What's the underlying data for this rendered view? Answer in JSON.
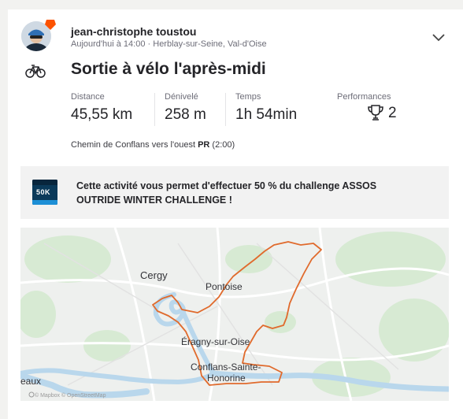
{
  "activity": {
    "athlete_name": "jean-christophe toustou",
    "date_time": "Aujourd'hui à 14:00",
    "location": "Herblay-sur-Seine, Val-d'Oise",
    "title": "Sortie à vélo l'après-midi",
    "sport_icon": "bike-icon",
    "expand_icon": "chevron-down-icon"
  },
  "stats": {
    "distance": {
      "label": "Distance",
      "value": "45,55 km"
    },
    "elevation": {
      "label": "Dénivelé",
      "value": "258 m"
    },
    "time": {
      "label": "Temps",
      "value": "1h 54min"
    },
    "performances": {
      "label": "Performances",
      "value": "2",
      "icon": "trophy-icon"
    }
  },
  "segment": {
    "name": "Chemin de Conflans vers l'ouest",
    "badge": "PR",
    "time": "(2:00)"
  },
  "challenge": {
    "text": "Cette activité vous permet d'effectuer 50 % du challenge ASSOS OUTRIDE WINTER CHALLENGE !",
    "logo_text": "50K"
  },
  "map": {
    "labels": {
      "cergy": "Cergy",
      "pontoise": "Pontoise",
      "eragny": "Éragny-sur-Oise",
      "conflans_1": "Conflans-Sainte-",
      "conflans_2": "Honorine",
      "eaux": "eaux"
    },
    "attribution": "© Mapbox © OpenStreetMap",
    "route_color": "#e06a2c",
    "water_color": "#b9d7ec",
    "park_color": "#d7ead3"
  },
  "colors": {
    "brand": "#fc5200",
    "text": "#242428",
    "muted": "#6d6d78"
  }
}
